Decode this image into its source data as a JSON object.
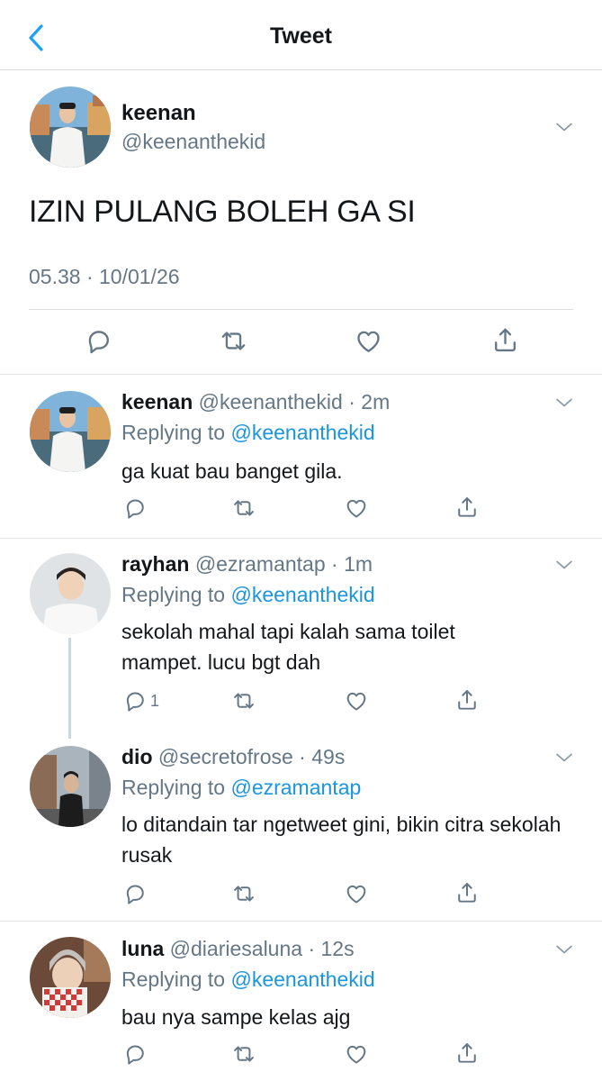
{
  "header": {
    "title": "Tweet"
  },
  "main_tweet": {
    "name": "keenan",
    "handle": "@keenanthekid",
    "text": "IZIN PULANG BOLEH GA SI",
    "timestamp": "05.38 · 10/01/26"
  },
  "replies": [
    {
      "name": "keenan",
      "handle": "@keenanthekid · 2m",
      "replying_prefix": "Replying to",
      "replying_to": "@keenanthekid",
      "text": "ga kuat bau banget gila.",
      "reply_count": ""
    },
    {
      "name": "rayhan",
      "handle": "@ezramantap · 1m",
      "replying_prefix": "Replying to",
      "replying_to": "@keenanthekid",
      "text": "sekolah mahal tapi kalah sama toilet mampet. lucu bgt dah",
      "reply_count": "1"
    },
    {
      "name": "dio",
      "handle": "@secretofrose · 49s",
      "replying_prefix": "Replying to",
      "replying_to": "@ezramantap",
      "text": "lo ditandain tar ngetweet gini, bikin citra sekolah rusak",
      "reply_count": ""
    },
    {
      "name": "luna",
      "handle": "@diariesaluna · 12s",
      "replying_prefix": "Replying to",
      "replying_to": "@keenanthekid",
      "text": "bau nya sampe kelas ajg",
      "reply_count": ""
    }
  ],
  "icons": {
    "back": "chevron-left-icon",
    "more": "chevron-down-icon",
    "reply": "comment-icon",
    "retweet": "retweet-icon",
    "like": "heart-icon",
    "share": "share-icon"
  },
  "colors": {
    "accent": "#1da1f2",
    "mention": "#1b95e0",
    "muted": "#657786",
    "icon": "#657786"
  }
}
